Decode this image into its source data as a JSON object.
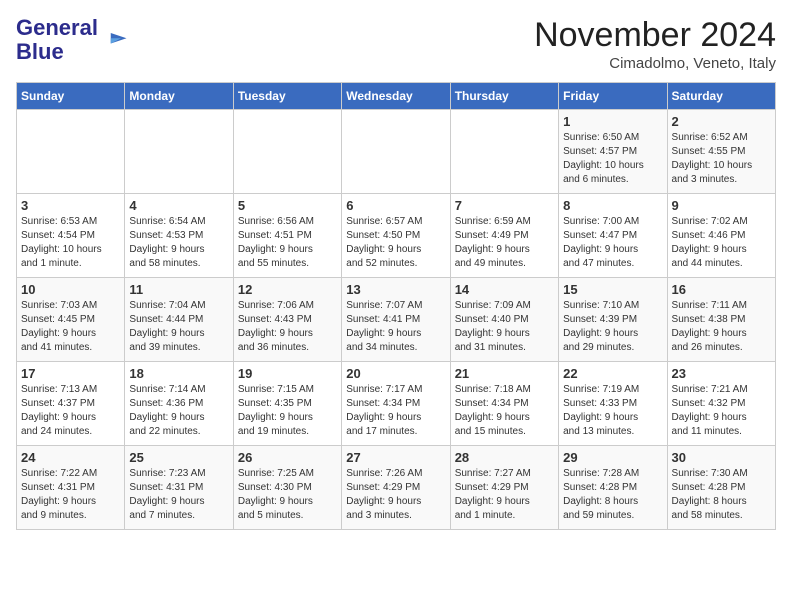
{
  "header": {
    "logo_line1": "General",
    "logo_line2": "Blue",
    "month_title": "November 2024",
    "location": "Cimadolmo, Veneto, Italy"
  },
  "weekdays": [
    "Sunday",
    "Monday",
    "Tuesday",
    "Wednesday",
    "Thursday",
    "Friday",
    "Saturday"
  ],
  "weeks": [
    [
      {
        "day": "",
        "info": ""
      },
      {
        "day": "",
        "info": ""
      },
      {
        "day": "",
        "info": ""
      },
      {
        "day": "",
        "info": ""
      },
      {
        "day": "",
        "info": ""
      },
      {
        "day": "1",
        "info": "Sunrise: 6:50 AM\nSunset: 4:57 PM\nDaylight: 10 hours\nand 6 minutes."
      },
      {
        "day": "2",
        "info": "Sunrise: 6:52 AM\nSunset: 4:55 PM\nDaylight: 10 hours\nand 3 minutes."
      }
    ],
    [
      {
        "day": "3",
        "info": "Sunrise: 6:53 AM\nSunset: 4:54 PM\nDaylight: 10 hours\nand 1 minute."
      },
      {
        "day": "4",
        "info": "Sunrise: 6:54 AM\nSunset: 4:53 PM\nDaylight: 9 hours\nand 58 minutes."
      },
      {
        "day": "5",
        "info": "Sunrise: 6:56 AM\nSunset: 4:51 PM\nDaylight: 9 hours\nand 55 minutes."
      },
      {
        "day": "6",
        "info": "Sunrise: 6:57 AM\nSunset: 4:50 PM\nDaylight: 9 hours\nand 52 minutes."
      },
      {
        "day": "7",
        "info": "Sunrise: 6:59 AM\nSunset: 4:49 PM\nDaylight: 9 hours\nand 49 minutes."
      },
      {
        "day": "8",
        "info": "Sunrise: 7:00 AM\nSunset: 4:47 PM\nDaylight: 9 hours\nand 47 minutes."
      },
      {
        "day": "9",
        "info": "Sunrise: 7:02 AM\nSunset: 4:46 PM\nDaylight: 9 hours\nand 44 minutes."
      }
    ],
    [
      {
        "day": "10",
        "info": "Sunrise: 7:03 AM\nSunset: 4:45 PM\nDaylight: 9 hours\nand 41 minutes."
      },
      {
        "day": "11",
        "info": "Sunrise: 7:04 AM\nSunset: 4:44 PM\nDaylight: 9 hours\nand 39 minutes."
      },
      {
        "day": "12",
        "info": "Sunrise: 7:06 AM\nSunset: 4:43 PM\nDaylight: 9 hours\nand 36 minutes."
      },
      {
        "day": "13",
        "info": "Sunrise: 7:07 AM\nSunset: 4:41 PM\nDaylight: 9 hours\nand 34 minutes."
      },
      {
        "day": "14",
        "info": "Sunrise: 7:09 AM\nSunset: 4:40 PM\nDaylight: 9 hours\nand 31 minutes."
      },
      {
        "day": "15",
        "info": "Sunrise: 7:10 AM\nSunset: 4:39 PM\nDaylight: 9 hours\nand 29 minutes."
      },
      {
        "day": "16",
        "info": "Sunrise: 7:11 AM\nSunset: 4:38 PM\nDaylight: 9 hours\nand 26 minutes."
      }
    ],
    [
      {
        "day": "17",
        "info": "Sunrise: 7:13 AM\nSunset: 4:37 PM\nDaylight: 9 hours\nand 24 minutes."
      },
      {
        "day": "18",
        "info": "Sunrise: 7:14 AM\nSunset: 4:36 PM\nDaylight: 9 hours\nand 22 minutes."
      },
      {
        "day": "19",
        "info": "Sunrise: 7:15 AM\nSunset: 4:35 PM\nDaylight: 9 hours\nand 19 minutes."
      },
      {
        "day": "20",
        "info": "Sunrise: 7:17 AM\nSunset: 4:34 PM\nDaylight: 9 hours\nand 17 minutes."
      },
      {
        "day": "21",
        "info": "Sunrise: 7:18 AM\nSunset: 4:34 PM\nDaylight: 9 hours\nand 15 minutes."
      },
      {
        "day": "22",
        "info": "Sunrise: 7:19 AM\nSunset: 4:33 PM\nDaylight: 9 hours\nand 13 minutes."
      },
      {
        "day": "23",
        "info": "Sunrise: 7:21 AM\nSunset: 4:32 PM\nDaylight: 9 hours\nand 11 minutes."
      }
    ],
    [
      {
        "day": "24",
        "info": "Sunrise: 7:22 AM\nSunset: 4:31 PM\nDaylight: 9 hours\nand 9 minutes."
      },
      {
        "day": "25",
        "info": "Sunrise: 7:23 AM\nSunset: 4:31 PM\nDaylight: 9 hours\nand 7 minutes."
      },
      {
        "day": "26",
        "info": "Sunrise: 7:25 AM\nSunset: 4:30 PM\nDaylight: 9 hours\nand 5 minutes."
      },
      {
        "day": "27",
        "info": "Sunrise: 7:26 AM\nSunset: 4:29 PM\nDaylight: 9 hours\nand 3 minutes."
      },
      {
        "day": "28",
        "info": "Sunrise: 7:27 AM\nSunset: 4:29 PM\nDaylight: 9 hours\nand 1 minute."
      },
      {
        "day": "29",
        "info": "Sunrise: 7:28 AM\nSunset: 4:28 PM\nDaylight: 8 hours\nand 59 minutes."
      },
      {
        "day": "30",
        "info": "Sunrise: 7:30 AM\nSunset: 4:28 PM\nDaylight: 8 hours\nand 58 minutes."
      }
    ]
  ]
}
